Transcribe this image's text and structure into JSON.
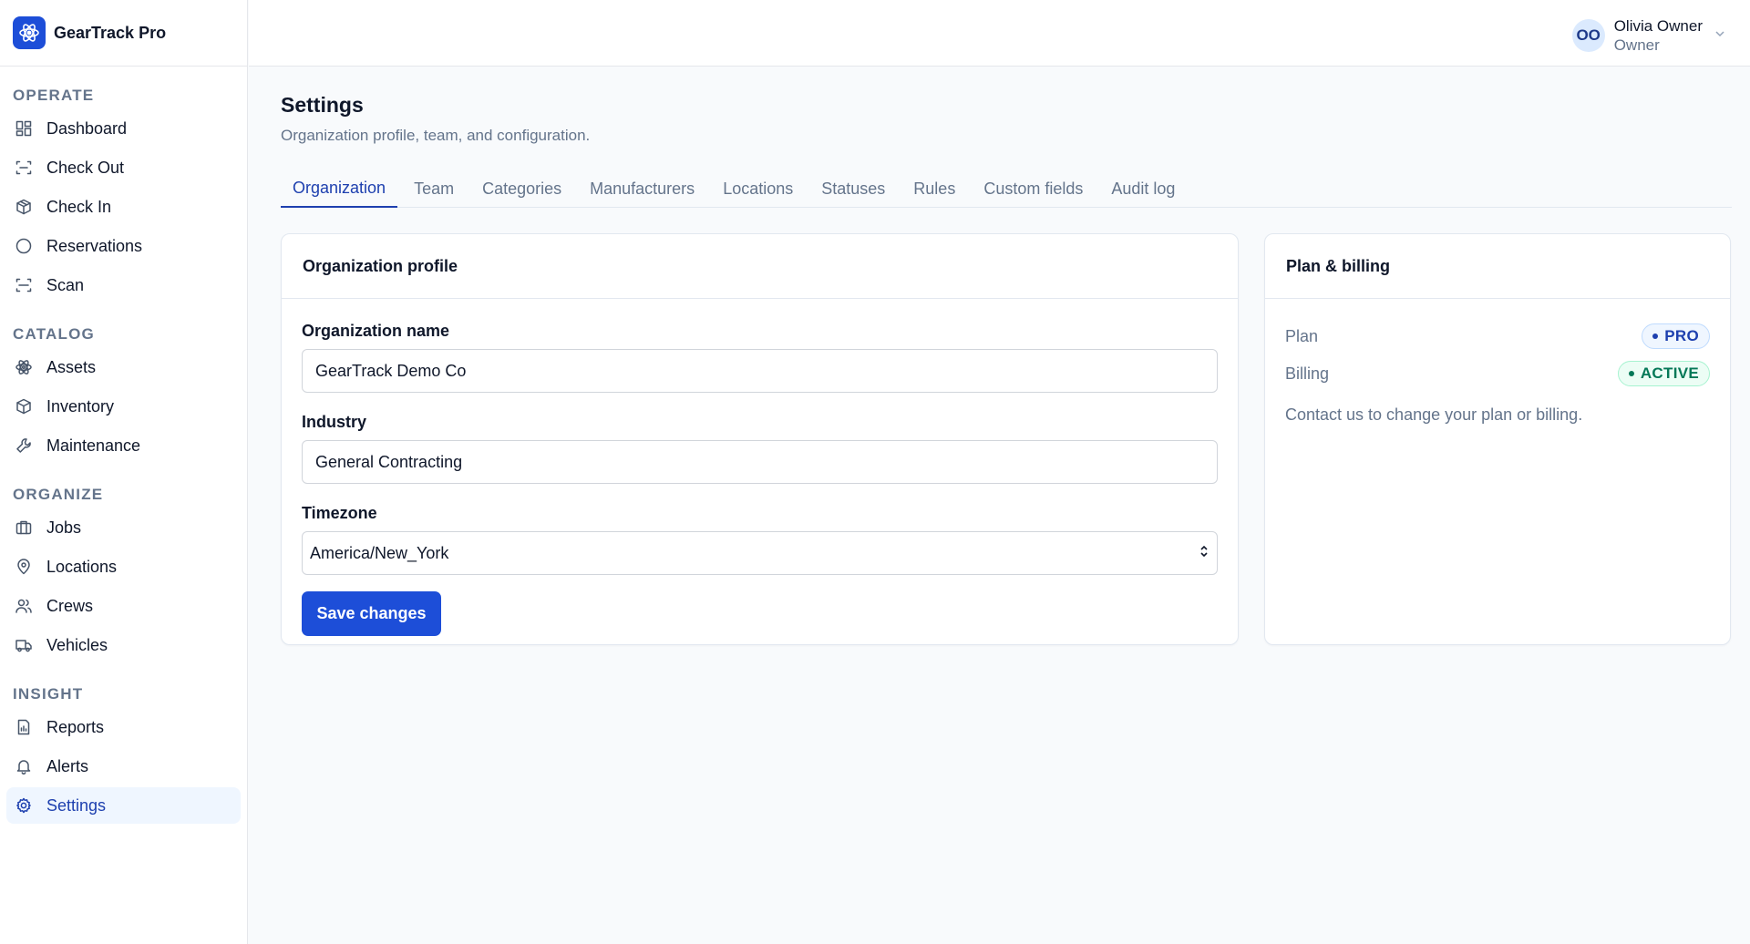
{
  "brand": {
    "name": "GearTrack Pro",
    "icon": "atom-logo-icon",
    "color": "#1d4ed8"
  },
  "sidebar": {
    "sections": [
      {
        "heading": "OPERATE",
        "items": [
          {
            "label": "Dashboard",
            "icon": "grid-icon"
          },
          {
            "label": "Check Out",
            "icon": "scan-frame-icon"
          },
          {
            "label": "Check In",
            "icon": "box-icon"
          },
          {
            "label": "Reservations",
            "icon": "circle-icon"
          },
          {
            "label": "Scan",
            "icon": "scan-icon"
          }
        ]
      },
      {
        "heading": "CATALOG",
        "items": [
          {
            "label": "Assets",
            "icon": "atom-icon"
          },
          {
            "label": "Inventory",
            "icon": "package-icon"
          },
          {
            "label": "Maintenance",
            "icon": "wrench-icon"
          }
        ]
      },
      {
        "heading": "ORGANIZE",
        "items": [
          {
            "label": "Jobs",
            "icon": "briefcase-icon"
          },
          {
            "label": "Locations",
            "icon": "map-pin-icon"
          },
          {
            "label": "Crews",
            "icon": "users-icon"
          },
          {
            "label": "Vehicles",
            "icon": "truck-icon"
          }
        ]
      },
      {
        "heading": "INSIGHT",
        "items": [
          {
            "label": "Reports",
            "icon": "report-icon"
          },
          {
            "label": "Alerts",
            "icon": "bell-icon"
          },
          {
            "label": "Settings",
            "icon": "gear-icon",
            "active": true
          }
        ]
      }
    ]
  },
  "user": {
    "initials": "OO",
    "name": "Olivia Owner",
    "role": "Owner"
  },
  "page": {
    "title": "Settings",
    "subtitle": "Organization profile, team, and configuration."
  },
  "tabs": [
    {
      "label": "Organization",
      "active": true
    },
    {
      "label": "Team"
    },
    {
      "label": "Categories"
    },
    {
      "label": "Manufacturers"
    },
    {
      "label": "Locations"
    },
    {
      "label": "Statuses"
    },
    {
      "label": "Rules"
    },
    {
      "label": "Custom fields"
    },
    {
      "label": "Audit log"
    }
  ],
  "org": {
    "card_title": "Organization profile",
    "name_label": "Organization name",
    "name_value": "GearTrack Demo Co",
    "industry_label": "Industry",
    "industry_value": "General Contracting",
    "timezone_label": "Timezone",
    "timezone_value": "America/New_York",
    "save_label": "Save changes"
  },
  "plan": {
    "card_title": "Plan & billing",
    "plan_label": "Plan",
    "plan_badge": "PRO",
    "billing_label": "Billing",
    "billing_badge": "ACTIVE",
    "note": "Contact us to change your plan or billing."
  }
}
